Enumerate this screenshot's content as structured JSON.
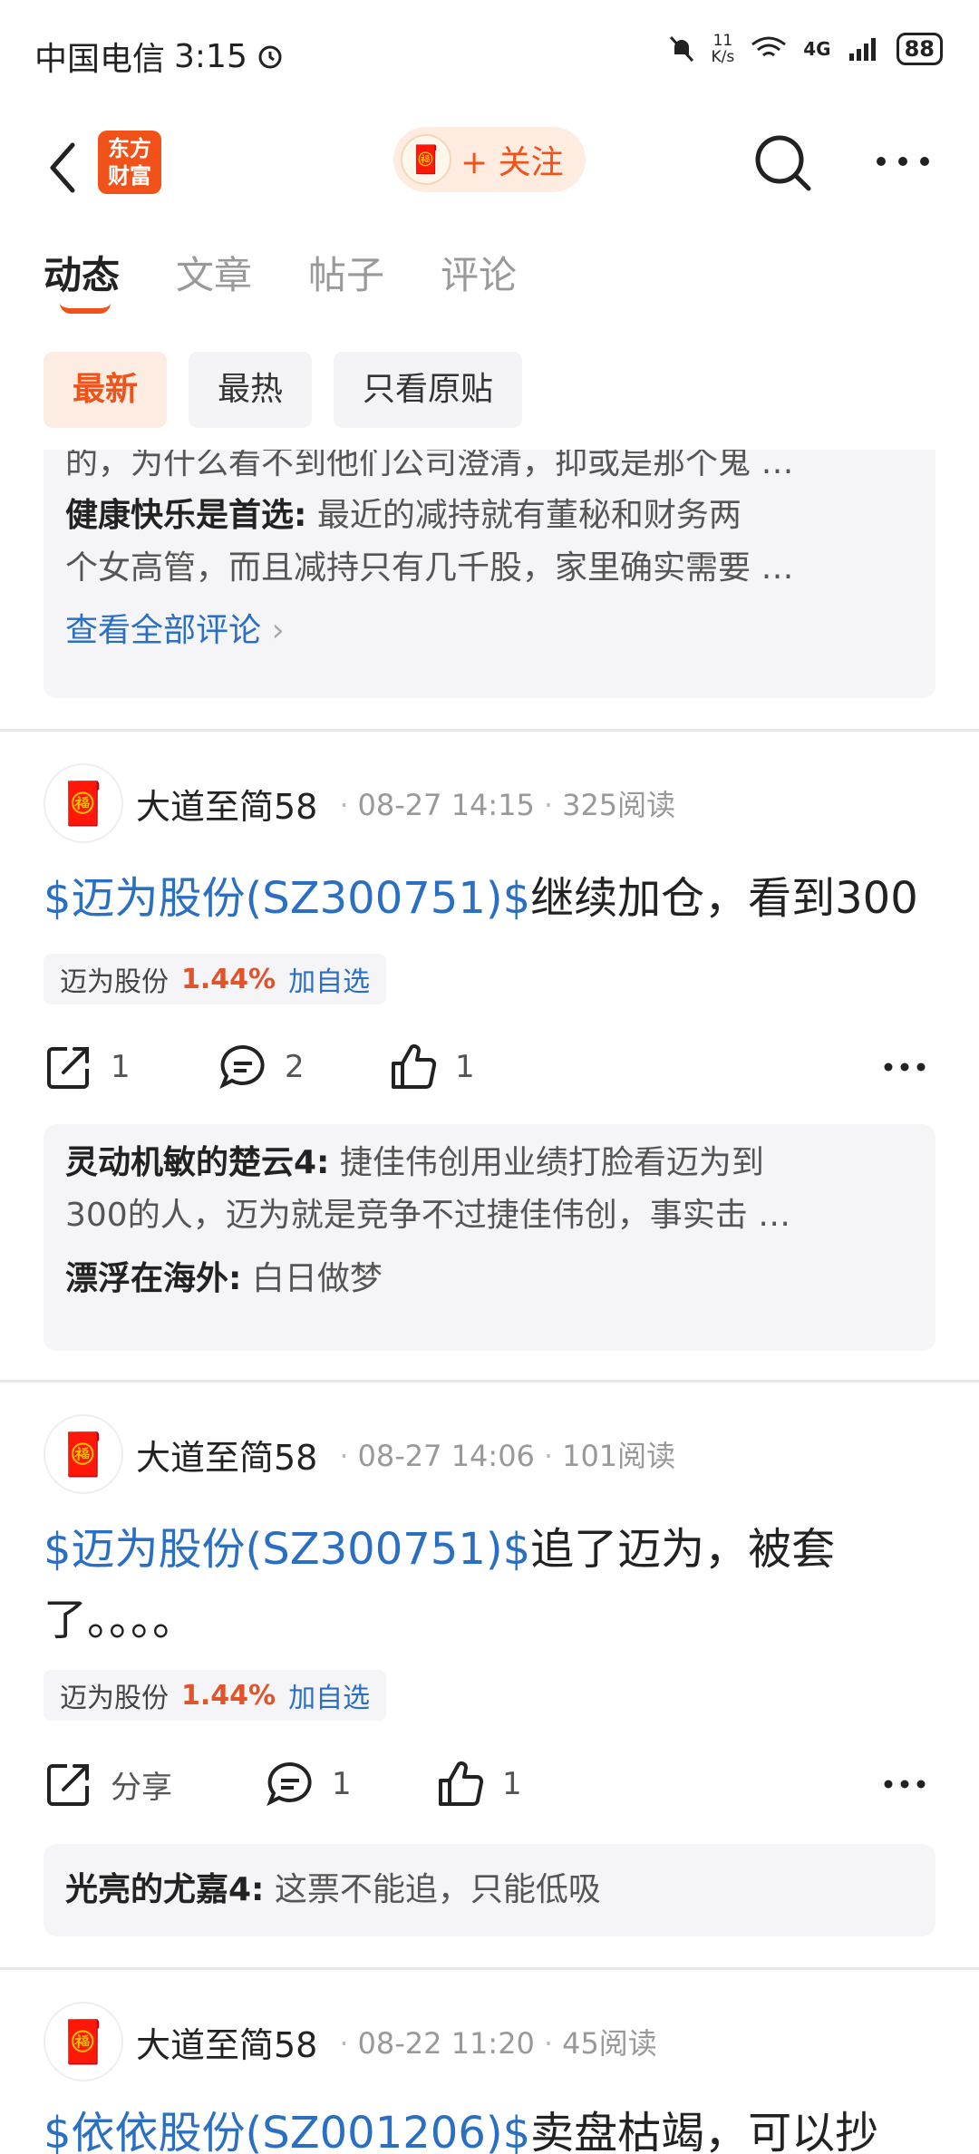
{
  "status_bar": {
    "carrier": "中国电信",
    "time": "3:15",
    "net_speed_top": "11",
    "net_speed_unit": "K/s",
    "net_type": "4G",
    "battery": "88"
  },
  "header": {
    "logo_line1": "东方",
    "logo_line2": "财富",
    "follow_label": "+ 关注"
  },
  "tabs": [
    {
      "label": "动态",
      "active": true
    },
    {
      "label": "文章"
    },
    {
      "label": "帖子"
    },
    {
      "label": "评论"
    }
  ],
  "filters": [
    {
      "label": "最新",
      "active": true
    },
    {
      "label": "最热"
    },
    {
      "label": "只看原贴"
    }
  ],
  "top_comments": {
    "partial_line": "的，为什么看不到他们公司澄清，抑或是那个鬼 …",
    "c1_author": "健康快乐是首选:",
    "c1_text_line1": "最近的减持就有董秘和财务两",
    "c1_text_line2": "个女高管，而且减持只有几千股，家里确实需要 …",
    "view_all": "查看全部评论"
  },
  "posts": [
    {
      "author": "大道至简58",
      "date": "08-27 14:15",
      "reads": "325阅读",
      "stock_link": "$迈为股份(SZ300751)$",
      "text": "继续加仓，看到300",
      "chip_name": "迈为股份",
      "chip_pct": "1.44%",
      "chip_add": "加自选",
      "share": "1",
      "comments": "2",
      "likes": "1",
      "c1_author": "灵动机敏的楚云4:",
      "c1_line1": "捷佳伟创用业绩打脸看迈为到",
      "c1_line2": "300的人，迈为就是竞争不过捷佳伟创，事实击 …",
      "c2_author": "漂浮在海外:",
      "c2_text": "白日做梦"
    },
    {
      "author": "大道至简58",
      "date": "08-27 14:06",
      "reads": "101阅读",
      "stock_link": "$迈为股份(SZ300751)$",
      "text_line1": "追了迈为，被套",
      "text_line2": "了。。。。",
      "chip_name": "迈为股份",
      "chip_pct": "1.44%",
      "chip_add": "加自选",
      "share": "分享",
      "comments": "1",
      "likes": "1",
      "c1_author": "光亮的尤嘉4:",
      "c1_text": "这票不能追，只能低吸"
    },
    {
      "author": "大道至简58",
      "date": "08-22 11:20",
      "reads": "45阅读",
      "stock_link": "$依依股份(SZ001206)$",
      "text": "卖盘枯竭，可以抄"
    }
  ]
}
